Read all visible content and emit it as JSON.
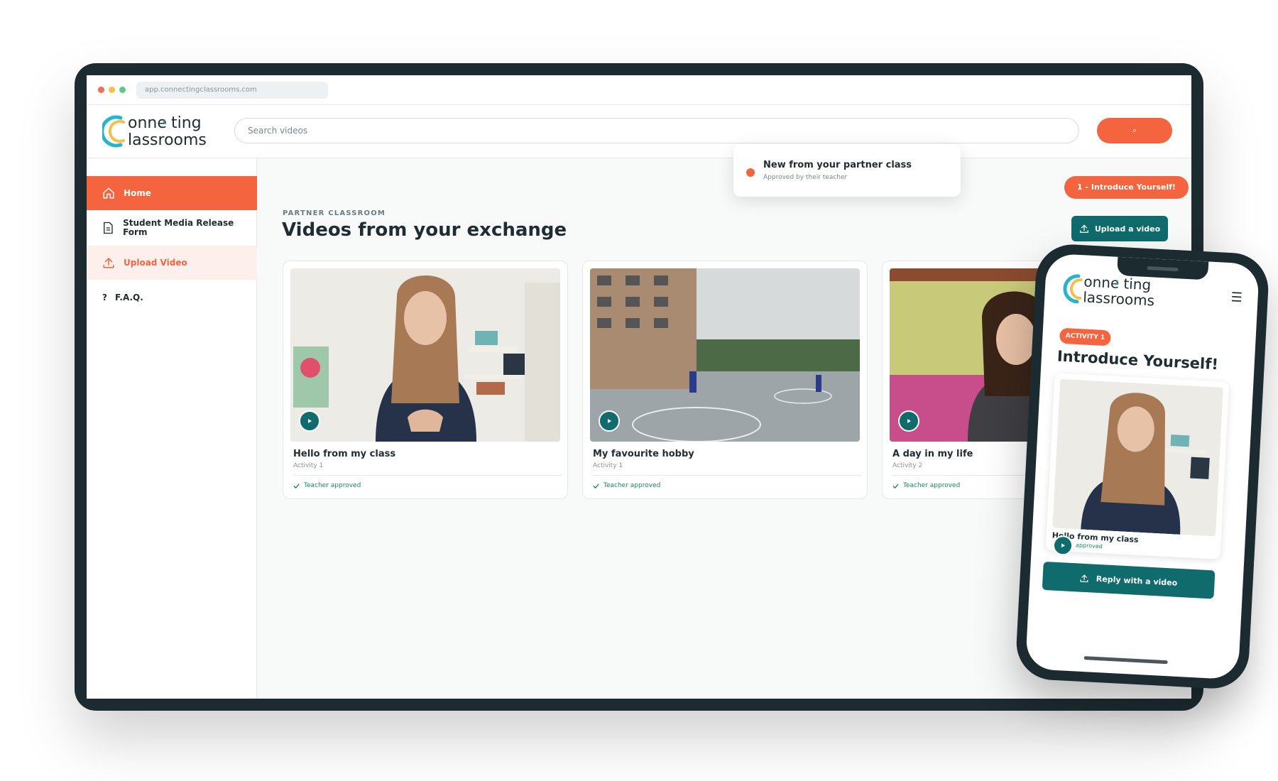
{
  "browser": {
    "url": "app.connectingclassrooms.com"
  },
  "brand": {
    "logo_line1": "onne",
    "logo_line1b": "ting",
    "logo_line2": "lassrooms",
    "accent": "#f4643f",
    "teal": "#0f6b6c",
    "logo_c_blue": "#2bb3c9",
    "logo_c_yellow": "#f3c04c"
  },
  "header": {
    "search_placeholder": "Search videos",
    "search_button_icon": "⌕"
  },
  "sidebar": {
    "items": [
      {
        "label": "Home",
        "icon": "home-icon"
      },
      {
        "label": "Student Media Release Form",
        "icon": "document-icon"
      },
      {
        "label": "Upload Video",
        "icon": "upload-icon"
      },
      {
        "label": "F.A.Q.",
        "icon": "question-icon",
        "icon_glyph": "?"
      }
    ]
  },
  "main": {
    "eyebrow": "PARTNER CLASSROOM",
    "title": "Videos from your exchange",
    "intro_button": "1 - Introduce Yourself!",
    "upload_button": "Upload a video",
    "toast": {
      "title": "New from your partner class",
      "subtitle": "Approved by their teacher"
    },
    "videos": [
      {
        "title": "Hello from my class",
        "activity": "Activity 1",
        "status": "Teacher approved"
      },
      {
        "title": "My favourite hobby",
        "activity": "Activity 1",
        "status": "Teacher approved"
      },
      {
        "title": "A day in my life",
        "activity": "Activity 2",
        "status": "Teacher approved"
      }
    ]
  },
  "phone": {
    "menu_icon": "☰",
    "activity_badge": "ACTIVITY 1",
    "title": "Introduce Yourself!",
    "video_title": "Hello from my class",
    "video_status": "approved",
    "reply_button": "Reply with a video"
  }
}
